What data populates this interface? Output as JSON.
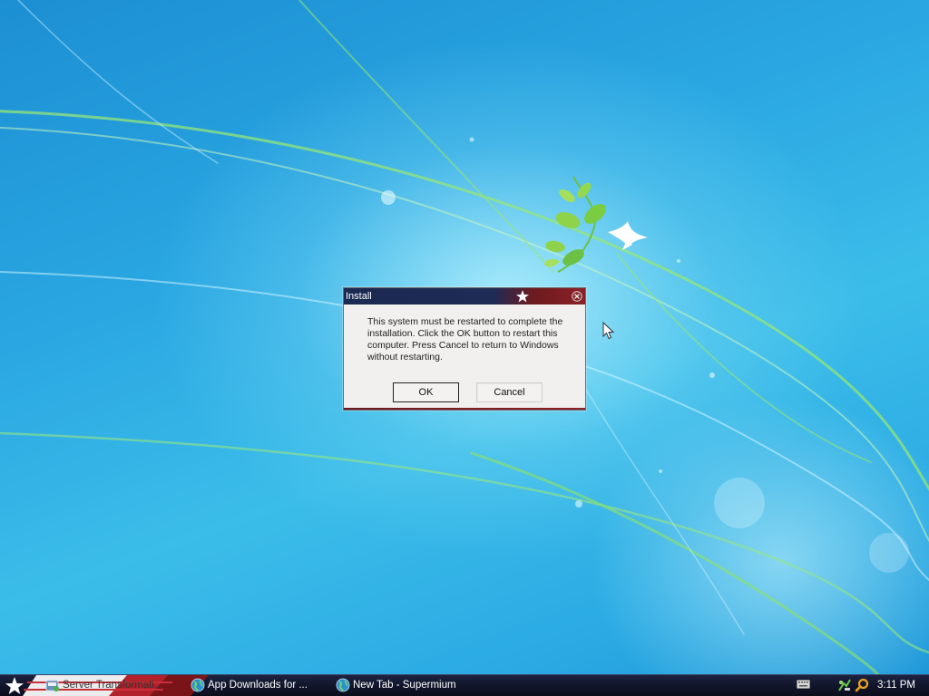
{
  "dialog": {
    "title": "Install",
    "message": "This system must be restarted to complete the installation. Click the OK button to restart this computer. Press Cancel to return to Windows without restarting.",
    "ok_label": "OK",
    "cancel_label": "Cancel",
    "icons": [
      "star-icon",
      "close-icon"
    ]
  },
  "taskbar": {
    "start_icon": "star-icon",
    "tasks": [
      {
        "label": "Server Transformati...",
        "icon": "installer-icon"
      },
      {
        "label": "App Downloads for ...",
        "icon": "globe-icon"
      },
      {
        "label": "New Tab - Supermium",
        "icon": "globe-icon"
      }
    ],
    "tray_icons": [
      "keyboard-icon",
      "network-icon",
      "search-icon"
    ],
    "clock": "3:11 PM"
  },
  "colors": {
    "desktop_blue": "#2aa7e2",
    "titlebar_navy": "#1e2b55",
    "titlebar_red": "#8c2026",
    "taskbar": "#12162b"
  }
}
